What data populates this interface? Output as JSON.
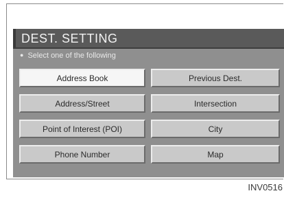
{
  "title": "DEST. SETTING",
  "subtitle": "Select one of the following",
  "buttons": {
    "address_book": "Address Book",
    "previous_dest": "Previous Dest.",
    "address_street": "Address/Street",
    "intersection": "Intersection",
    "poi": "Point of Interest (POI)",
    "city": "City",
    "phone_number": "Phone Number",
    "map": "Map"
  },
  "selected": "address_book",
  "figure_code": "INV0516"
}
